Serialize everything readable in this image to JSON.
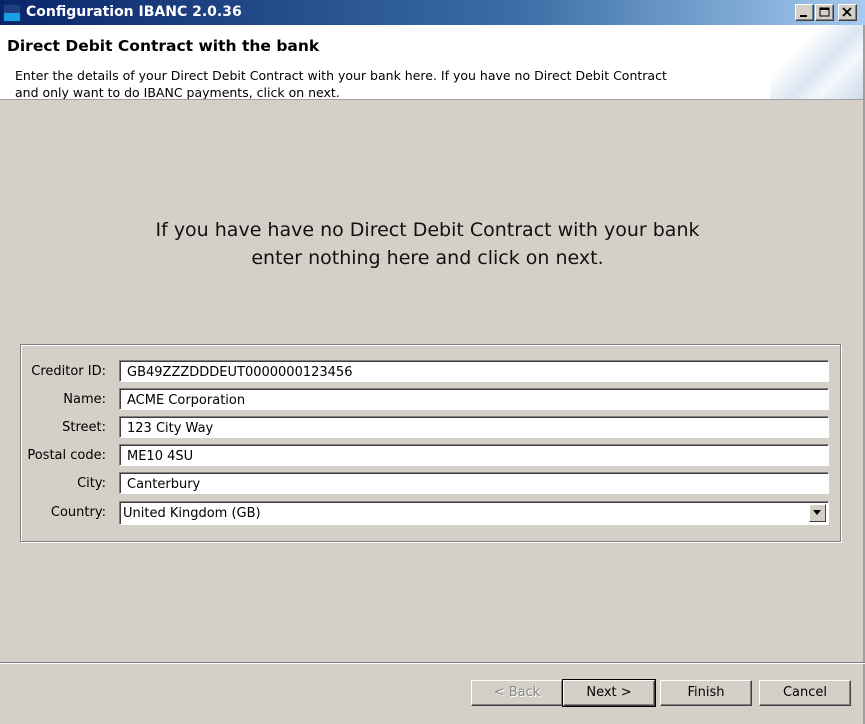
{
  "window": {
    "title": "Configuration IBANC 2.0.36",
    "controls": [
      "minimize-icon",
      "maximize-icon",
      "close-icon"
    ]
  },
  "header": {
    "title": "Direct Debit Contract with the bank",
    "description": "Enter the details of your Direct Debit Contract with your bank here. If you have no Direct Debit Contract\n and only want to do IBANC payments, click on next."
  },
  "notice": "If you have have no Direct Debit Contract with your bank\nenter nothing here and click on next.",
  "form": {
    "creditor_id": {
      "label": "Creditor ID:",
      "value": "GB49ZZZDDDEUT0000000123456"
    },
    "name": {
      "label": "Name:",
      "value": "ACME Corporation"
    },
    "street": {
      "label": "Street:",
      "value": "123 City Way"
    },
    "postal_code": {
      "label": "Postal code:",
      "value": "ME10 4SU"
    },
    "city": {
      "label": "City:",
      "value": "Canterbury"
    },
    "country": {
      "label": "Country:",
      "value": "United Kingdom (GB)"
    }
  },
  "buttons": {
    "back": "< Back",
    "next": "Next >",
    "finish": "Finish",
    "cancel": "Cancel"
  },
  "colors": {
    "titlebar_start": "#0a246a",
    "titlebar_end": "#a6caf0",
    "dialog_bg": "#d4d0c8",
    "header_bg": "#ffffff"
  }
}
